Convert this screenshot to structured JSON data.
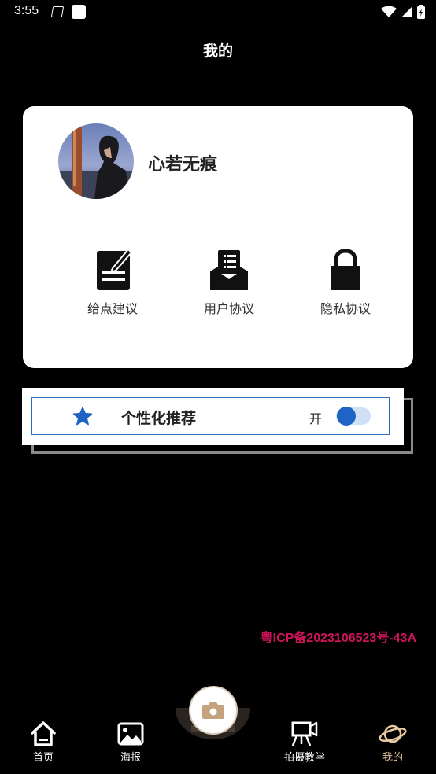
{
  "status_bar": {
    "time": "3:55"
  },
  "header": {
    "title": "我的"
  },
  "profile": {
    "username": "心若无痕"
  },
  "actions": [
    {
      "label": "给点建议",
      "icon": "edit-note-icon"
    },
    {
      "label": "用户协议",
      "icon": "document-tray-icon"
    },
    {
      "label": "隐私协议",
      "icon": "lock-icon"
    }
  ],
  "personalization": {
    "label": "个性化推荐",
    "state_text": "开",
    "enabled": true,
    "icon": "star-icon"
  },
  "footer": {
    "icp": "粤ICP备2023106523号-43A"
  },
  "bottom_nav": [
    {
      "label": "首页",
      "icon": "home-icon"
    },
    {
      "label": "海报",
      "icon": "image-icon"
    },
    {
      "label": "",
      "icon": "camera-icon"
    },
    {
      "label": "拍摄教学",
      "icon": "video-board-icon"
    },
    {
      "label": "我的",
      "icon": "planet-icon",
      "active": true
    }
  ],
  "colors": {
    "accent_blue": "#1f63c4",
    "icp_red": "#d1145a",
    "active_tab": "#e8c9a0"
  }
}
